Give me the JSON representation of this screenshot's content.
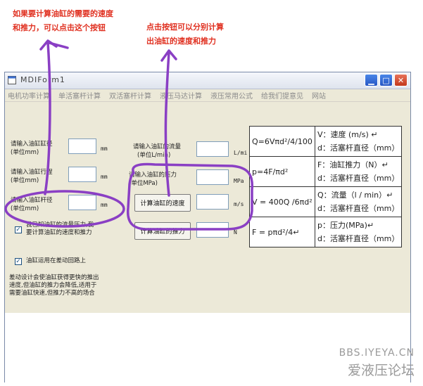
{
  "annotations": {
    "left": [
      "如果要计算油缸的需要的速度",
      "和推力，可以点击这个按钮"
    ],
    "right": [
      "点击按钮可以分别计算",
      "出油缸的速度和推力"
    ]
  },
  "window": {
    "title": "MDIForm1"
  },
  "menu": [
    "电机功率计算",
    "单活塞杆计算",
    "双活塞杆计算",
    "液压马达计算",
    "液压常用公式",
    "给我们提意见",
    "网站"
  ],
  "fields": {
    "bore": {
      "label_line1": "请输入油缸缸径",
      "label_line2": "(单位mm)",
      "unit": "mm"
    },
    "stroke": {
      "label_line1": "请输入油缸行程",
      "label_line2": "(单位mm)",
      "unit": "mm"
    },
    "rod": {
      "label_line1": "请输入油缸杆径",
      "label_line2": "(单位mm)",
      "unit": "mm"
    },
    "flow": {
      "label_line1": "请输入油缸的流量",
      "label_line2": "(单位L/min)",
      "unit": "L/mi"
    },
    "pressure": {
      "label_line1": "请输入油缸的压力",
      "label_line2": "(单位MPa)",
      "unit": "MPa"
    }
  },
  "buttons": {
    "calc_speed": {
      "label": "计算油缸的速度",
      "unit": "m/s"
    },
    "calc_force": {
      "label": "计算油缸的推力",
      "unit": "N"
    }
  },
  "checkboxes": {
    "known_flow": {
      "line1": "我已知油缸的流量压力,我",
      "line2": "要计算油缸的速度和推力",
      "checked": "✓"
    },
    "differential": {
      "label": "油缸运用在差动回路上",
      "checked": "✓"
    }
  },
  "note": [
    "差动设计会使油缸获得更快的推出",
    "速度,但油缸的推力会降低,适用于",
    "需要油缸快速,但推力不高的场合"
  ],
  "formulas": [
    {
      "formula": "Q=6Vπd²/4/100",
      "desc1": "V：速度 (m/s) ↵",
      "desc2": "d：活塞杆直径（mm）"
    },
    {
      "formula": "p=4F/πd²",
      "desc1": "F：油缸推力（N）↵",
      "desc2": "d：活塞杆直径（mm）"
    },
    {
      "formula": "V = 400Q /6πd²",
      "desc1": "Q：流量（l / min）↵",
      "desc2": "d：活塞杆直径（mm）"
    },
    {
      "formula": "F = pπd²/4↵",
      "desc1": "p：压力(MPa)↵",
      "desc2": "d：活塞杆直径（mm）"
    }
  ],
  "watermark": {
    "line1": "BBS.IYEYA.CN",
    "line2": "爱液压论坛"
  },
  "colors": {
    "annotation_red": "#e03020",
    "highlight_purple": "#8a3fc4"
  }
}
